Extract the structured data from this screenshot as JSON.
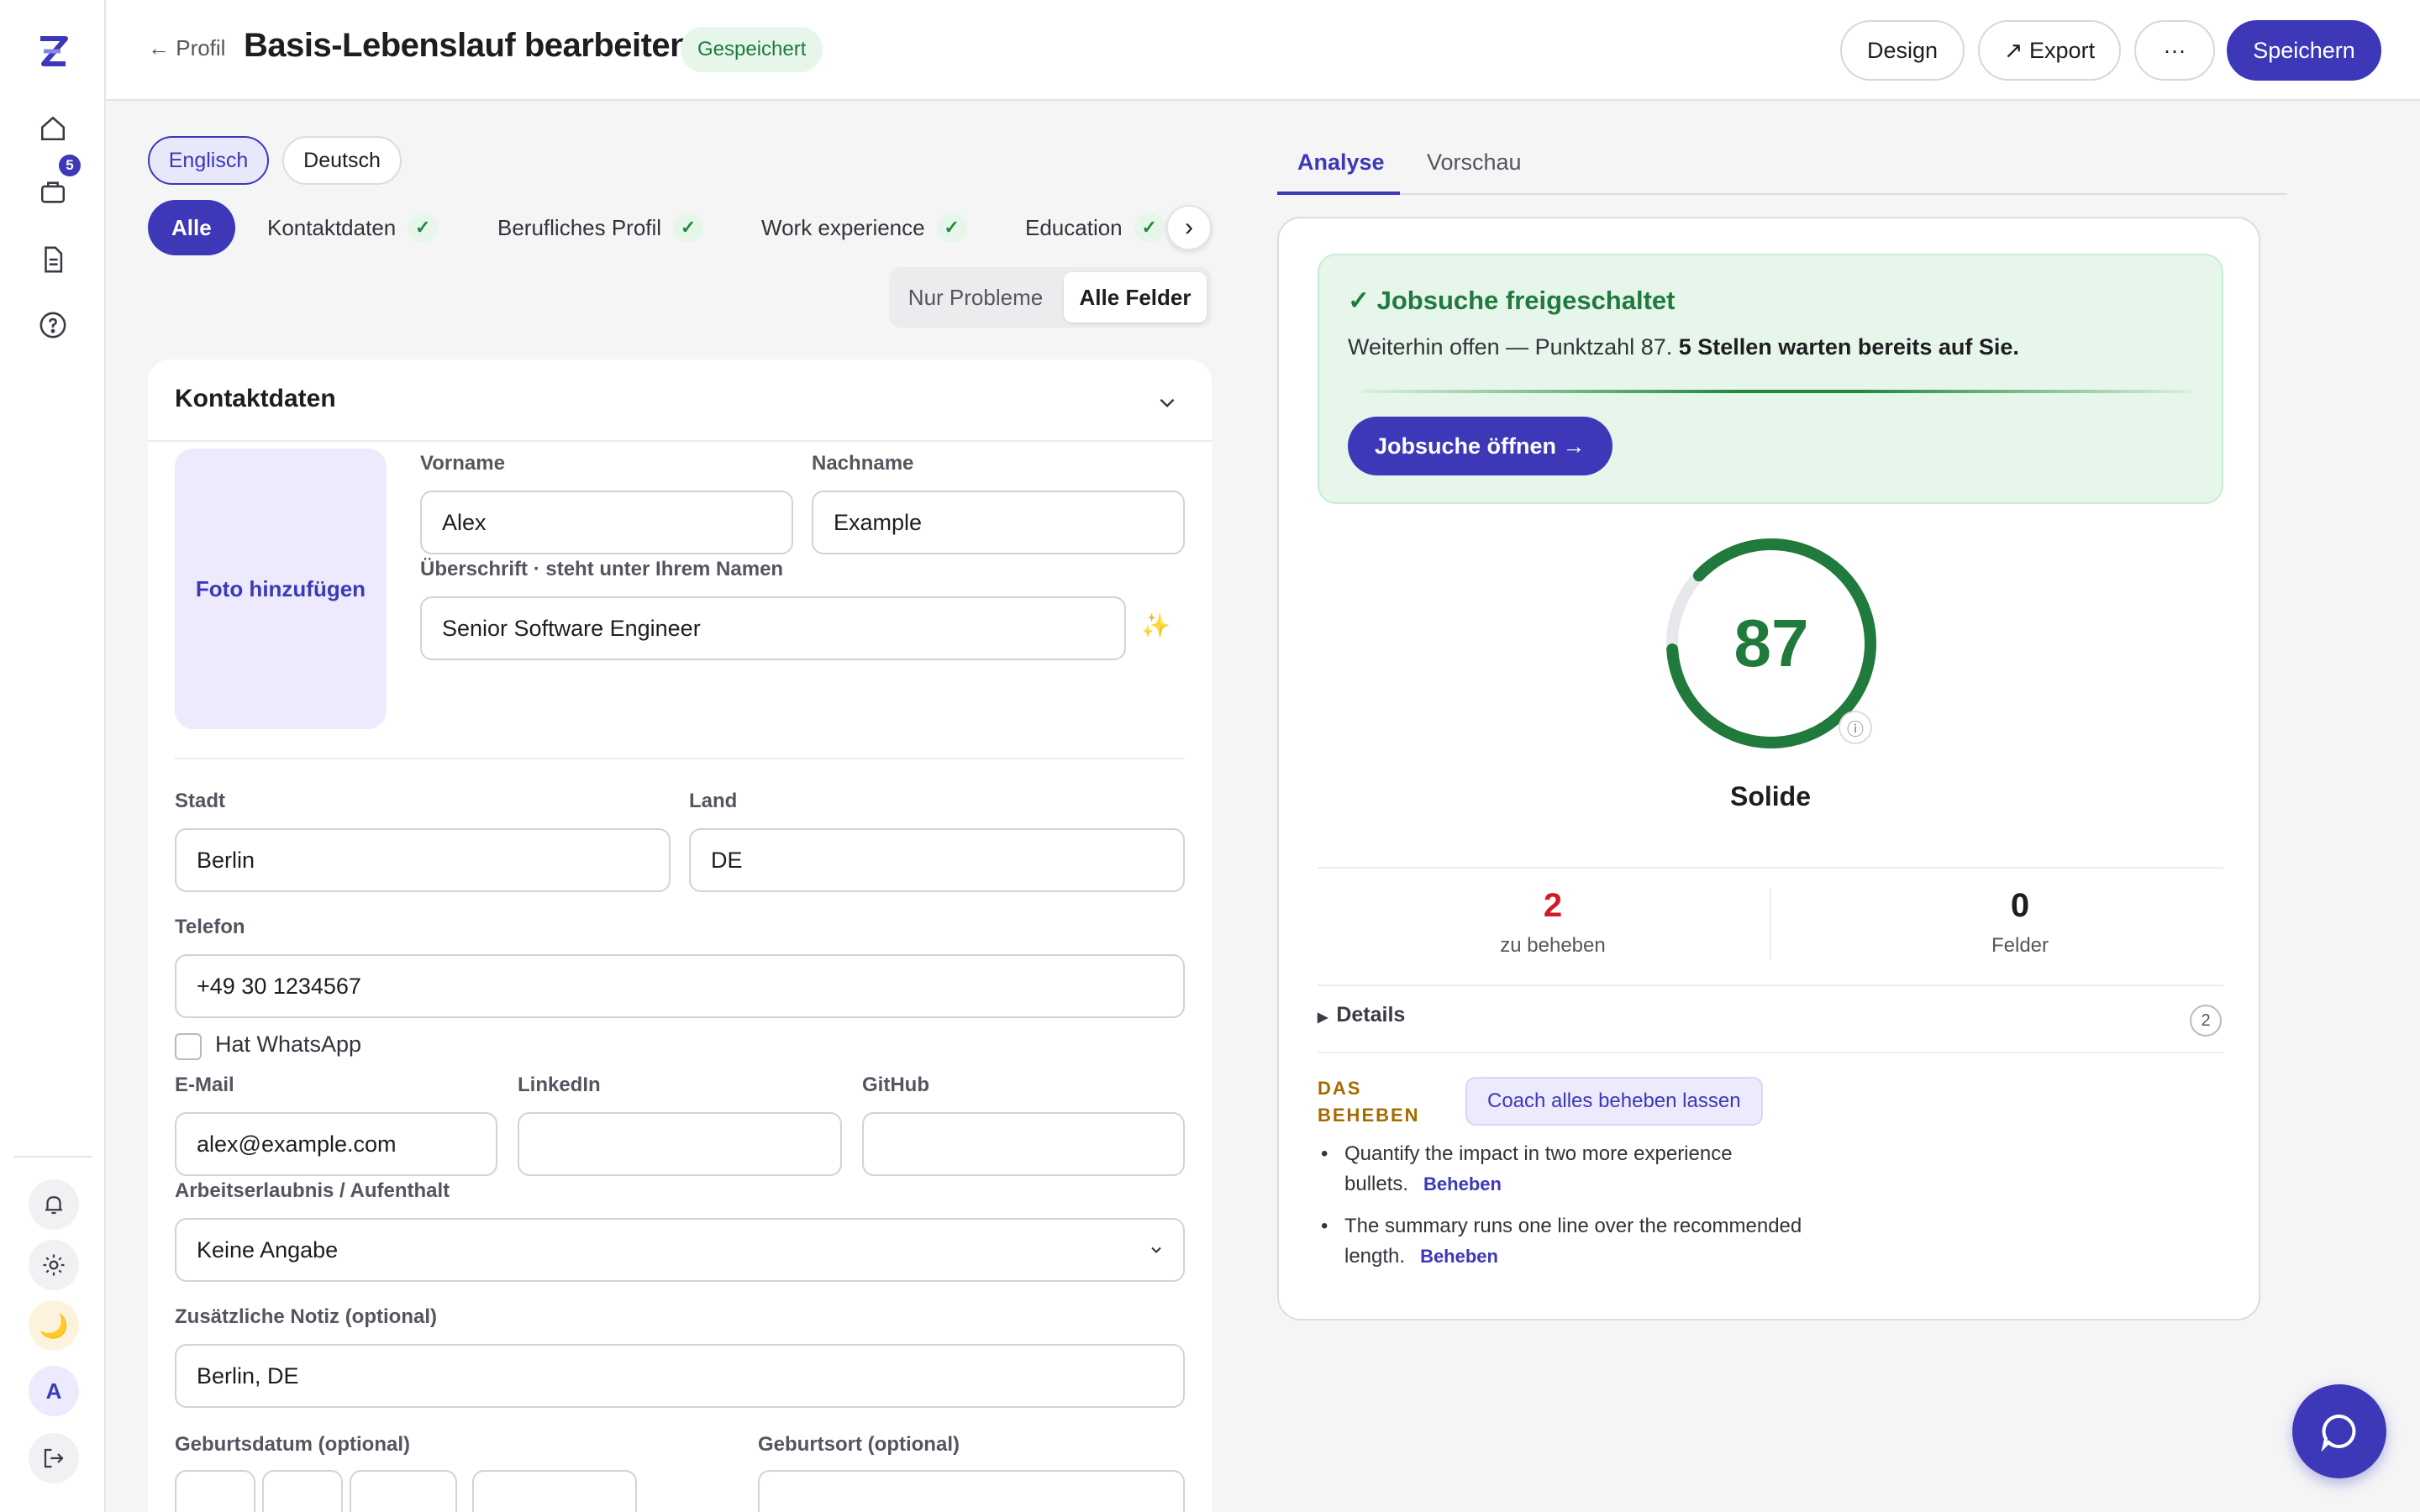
{
  "rail": {
    "notification_count": "5",
    "avatar_letter": "A"
  },
  "header": {
    "back_label": "← Profil",
    "title": "Basis-Lebenslauf bearbeiten",
    "saved_badge": "Gespeichert",
    "design_label": "Design",
    "export_label": "↗ Export",
    "more_label": "···",
    "save_label": "Speichern"
  },
  "languages": [
    "Englisch",
    "Deutsch"
  ],
  "section_tabs": {
    "all": "Alle",
    "items": [
      "Kontaktdaten",
      "Berufliches Profil",
      "Work experience",
      "Education"
    ],
    "check": "✓",
    "next": "›"
  },
  "filter": {
    "problems_only": "Nur Probleme",
    "all_fields": "Alle Felder"
  },
  "contact": {
    "title": "Kontaktdaten",
    "photo_label": "Foto hinzufügen",
    "first_name_label": "Vorname",
    "first_name": "Alex",
    "last_name_label": "Nachname",
    "last_name": "Example",
    "headline_label": "Überschrift · steht unter Ihrem Namen",
    "headline": "Senior Software Engineer",
    "city_label": "Stadt",
    "city": "Berlin",
    "country_label": "Land",
    "country": "DE",
    "phone_label": "Telefon",
    "phone": "+49 30 1234567",
    "whatsapp_label": "Hat WhatsApp",
    "email_label": "E-Mail",
    "email": "alex@example.com",
    "linkedin_label": "LinkedIn",
    "linkedin": "",
    "github_label": "GitHub",
    "github": "",
    "permit_label": "Arbeitserlaubnis / Aufenthalt",
    "permit_value": "Keine Angabe",
    "note_label": "Zusätzliche Notiz (optional)",
    "note": "Berlin, DE",
    "birthdate_label": "Geburtsdatum (optional)",
    "birthplace_label": "Geburtsort (optional)"
  },
  "right_tabs": [
    "Analyse",
    "Vorschau"
  ],
  "analysis": {
    "unlock_title": "✓ Jobsuche freigeschaltet",
    "unlock_text": "Weiterhin offen — Punktzahl 87.",
    "unlock_bold": "5 Stellen warten bereits auf Sie.",
    "unlock_button": "Jobsuche öffnen →",
    "score": "87",
    "score_fraction": 0.87,
    "info_glyph": "ⓘ",
    "score_label": "Solide",
    "to_fix_count": "2",
    "to_fix_label": "zu beheben",
    "fields_count": "0",
    "fields_label": "Felder",
    "details_label": "Details",
    "details_count": "2",
    "fix_heading": "DAS BEHEBEN",
    "coach_button": "Coach alles beheben lassen",
    "fix_items": [
      {
        "text": "Quantify the impact in two more experience bullets.",
        "action": "Beheben"
      },
      {
        "text": "The summary runs one line over the recommended length.",
        "action": "Beheben"
      }
    ]
  },
  "colors": {
    "accent": "#3c38b8",
    "success": "#1f8a3c",
    "warning": "#a86a00",
    "danger": "#d11a2a"
  }
}
